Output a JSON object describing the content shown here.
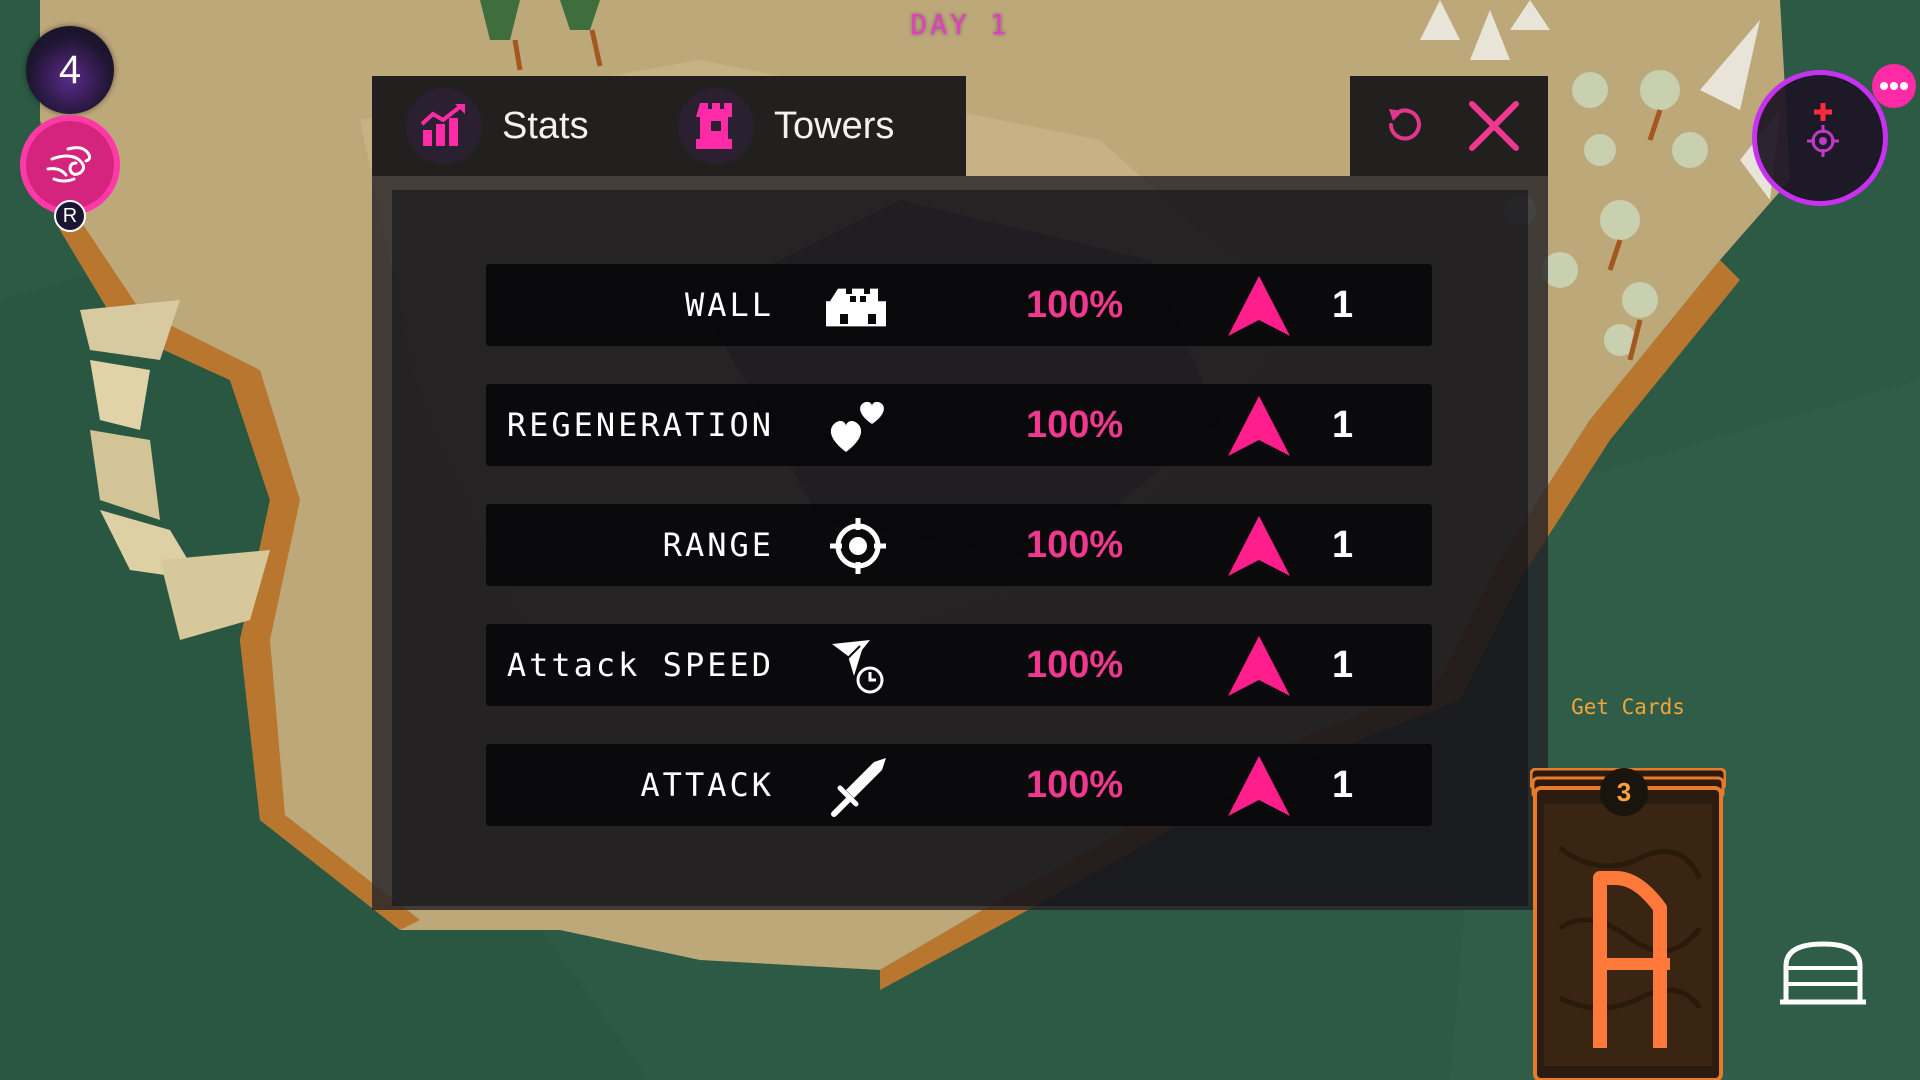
{
  "hud": {
    "day_label": "DAY 1",
    "wave_count": "4",
    "ability_hotkey": "R"
  },
  "tabs": [
    {
      "label": "Stats",
      "icon": "stats-chart-icon",
      "active": true
    },
    {
      "label": "Towers",
      "icon": "tower-icon",
      "active": false
    }
  ],
  "actions": {
    "reset_icon": "reset-icon",
    "close_icon": "close-icon"
  },
  "stats": [
    {
      "name": "WALL",
      "icon": "wall-icon",
      "value": "100%",
      "level": "1"
    },
    {
      "name": "REGENERATION",
      "icon": "hearts-icon",
      "value": "100%",
      "level": "1"
    },
    {
      "name": "RANGE",
      "icon": "crosshair-icon",
      "value": "100%",
      "level": "1"
    },
    {
      "name": "Attack SPEED",
      "icon": "attack-speed-icon",
      "value": "100%",
      "level": "1"
    },
    {
      "name": "ATTACK",
      "icon": "sword-icon",
      "value": "100%",
      "level": "1"
    }
  ],
  "cards": {
    "label": "Get Cards",
    "count": "3",
    "rune": "ᚱ"
  },
  "colors": {
    "accent_pink": "#f0388e",
    "magenta": "#e23cc8",
    "purple_ring": "#c732f0",
    "card_orange": "#f0a53a",
    "panel_bg": "#161418"
  }
}
